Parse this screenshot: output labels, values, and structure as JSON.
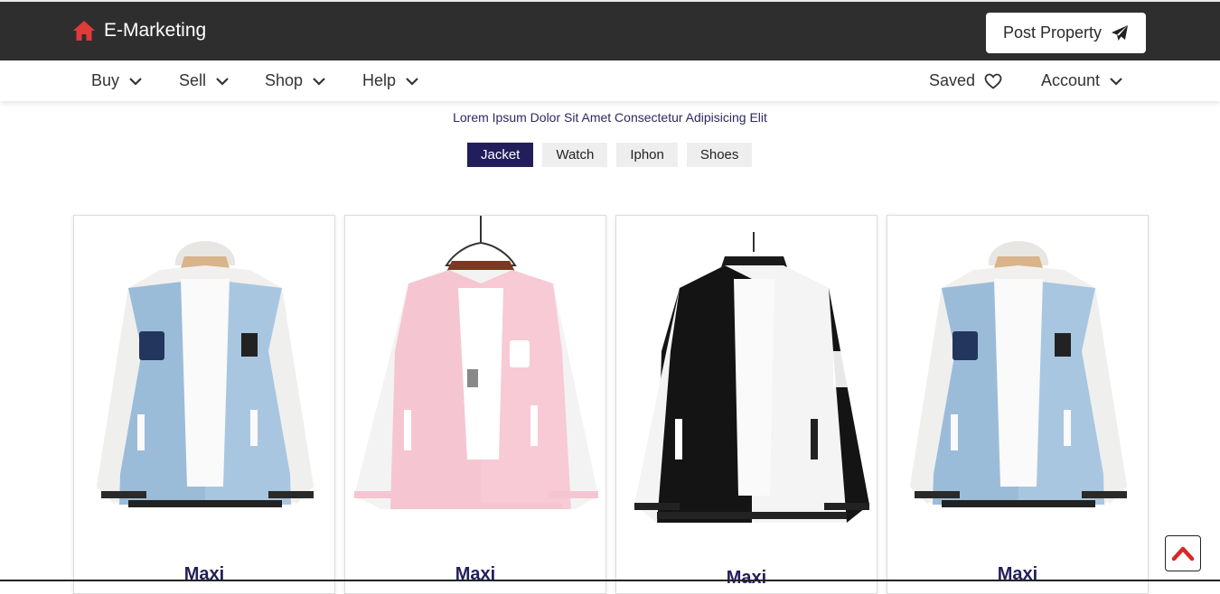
{
  "header": {
    "brand": "E-Marketing",
    "brand_icon": "home-icon",
    "post_button": "Post Property",
    "post_icon": "paper-plane-icon"
  },
  "nav": {
    "left": [
      {
        "label": "Buy",
        "icon": "chevron-down-icon"
      },
      {
        "label": "Sell",
        "icon": "chevron-down-icon"
      },
      {
        "label": "Shop",
        "icon": "chevron-down-icon"
      },
      {
        "label": "Help",
        "icon": "chevron-down-icon"
      }
    ],
    "saved": {
      "label": "Saved",
      "icon": "heart-icon"
    },
    "account": {
      "label": "Account",
      "icon": "chevron-down-icon"
    }
  },
  "tagline": "Lorem Ipsum Dolor Sit Amet Consectetur Adipisicing Elit",
  "tabs": [
    {
      "label": "Jacket",
      "active": true
    },
    {
      "label": "Watch",
      "active": false
    },
    {
      "label": "Iphon",
      "active": false
    },
    {
      "label": "Shoes",
      "active": false
    }
  ],
  "products": [
    {
      "title": "Maxi",
      "image": "blue-varsity-jacket"
    },
    {
      "title": "Maxi",
      "image": "pink-varsity-jacket"
    },
    {
      "title": "Maxi",
      "image": "black-white-varsity-jacket"
    },
    {
      "title": "Maxi",
      "image": "blue-varsity-jacket"
    }
  ],
  "colors": {
    "topbar": "#2e2e2e",
    "brand_red": "#e03a3a",
    "accent_navy": "#221e5c",
    "scroll_top_red": "#d62828"
  },
  "scroll_top_icon": "chevron-up-icon"
}
